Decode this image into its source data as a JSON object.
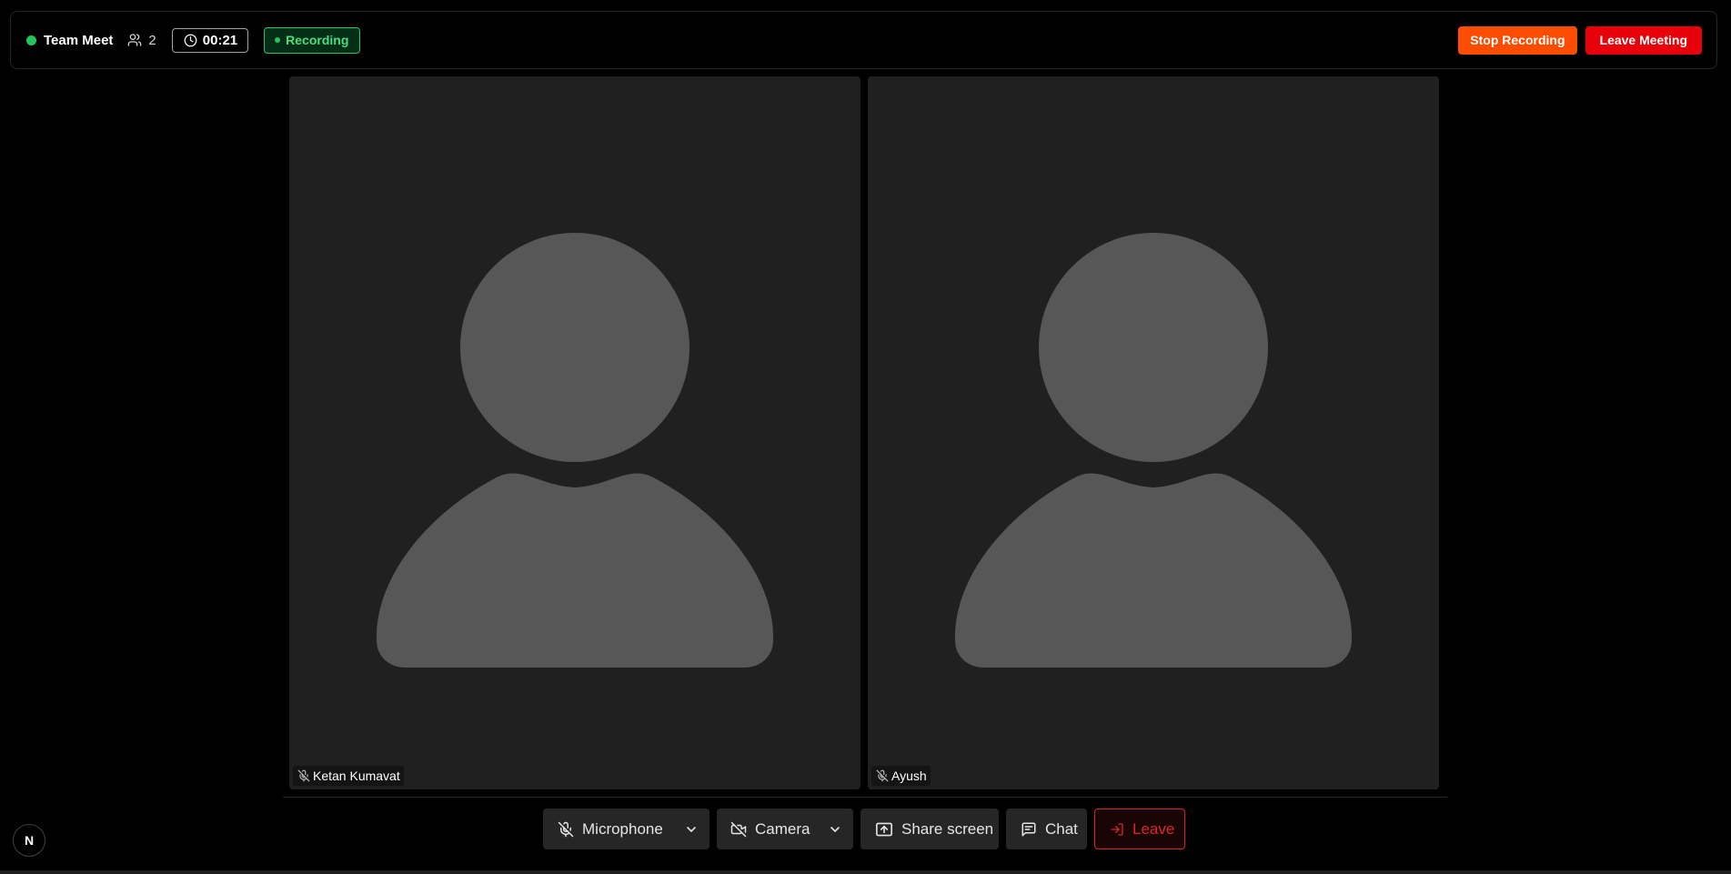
{
  "header": {
    "meeting_title": "Team Meet",
    "participant_count": "2",
    "timer": "00:21",
    "recording_label": "Recording",
    "stop_recording_label": "Stop Recording",
    "leave_meeting_label": "Leave Meeting"
  },
  "tiles": [
    {
      "name": "Ketan Kumavat",
      "muted": true
    },
    {
      "name": "Ayush",
      "muted": true
    }
  ],
  "controls": {
    "microphone_label": "Microphone",
    "camera_label": "Camera",
    "share_label": "Share screen",
    "chat_label": "Chat",
    "leave_label": "Leave"
  },
  "badge": {
    "letter": "N"
  },
  "colors": {
    "background": "#000000",
    "tile": "#202020",
    "avatar": "#575757",
    "live": "#22c55e",
    "stop_recording": "#fc4c02",
    "leave": "#e8000b",
    "leave_outline": "#dc2626"
  }
}
